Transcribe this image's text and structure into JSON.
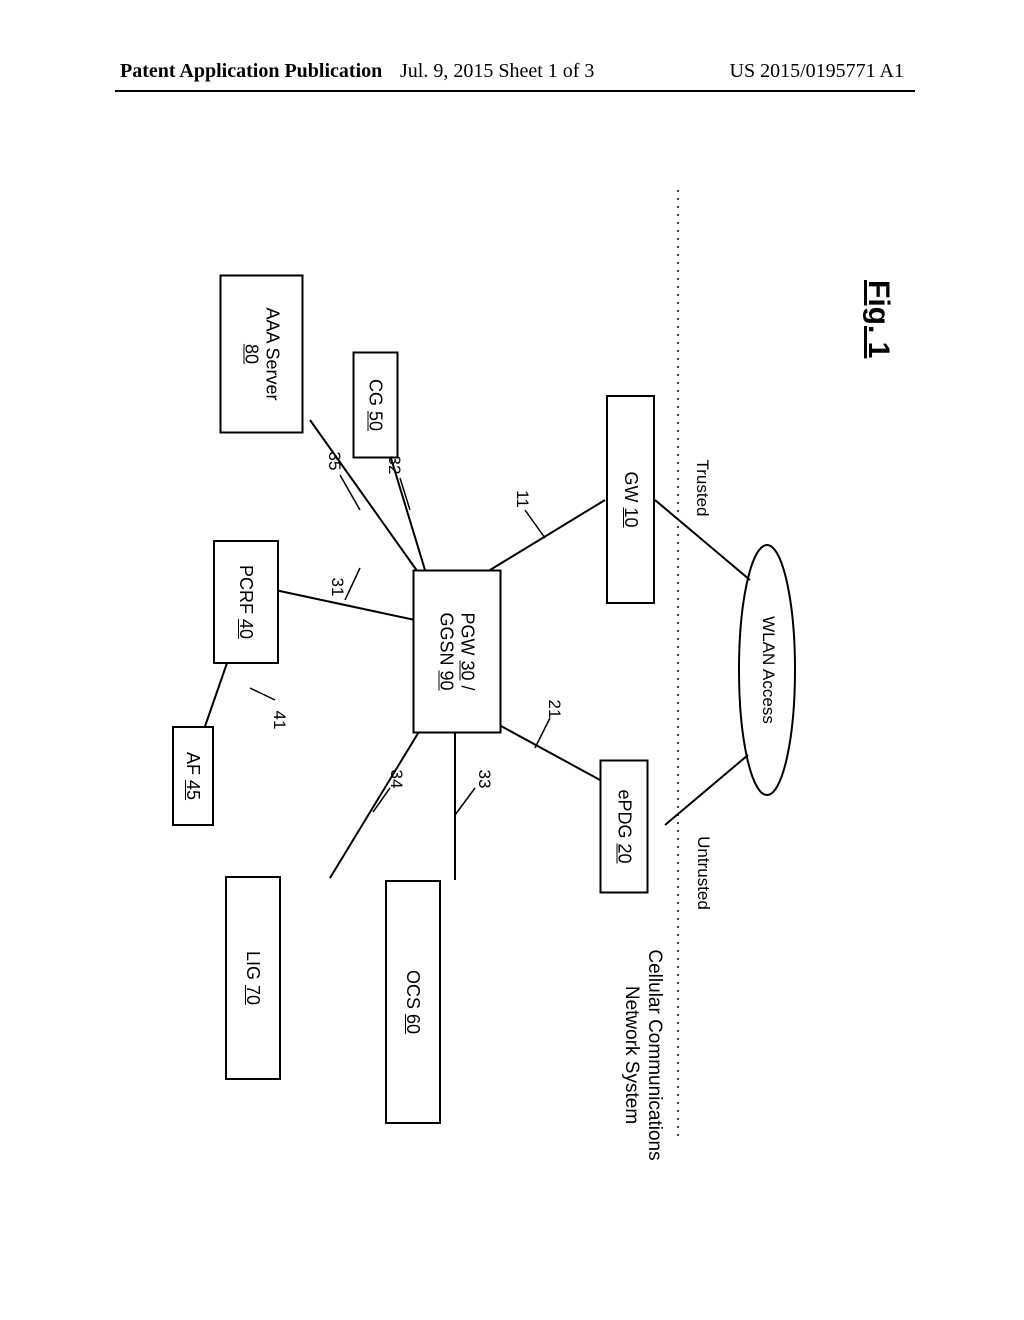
{
  "header": {
    "left": "Patent Application Publication",
    "center": "Jul. 9, 2015  Sheet 1 of 3",
    "right": "US 2015/0195771 A1"
  },
  "diagram": {
    "title": "Cellular Communications Network System",
    "figure_label": "Fig. 1",
    "boxes": {
      "af": {
        "label": "AF ",
        "num": "45"
      },
      "pcrf": {
        "label": "PCRF ",
        "num": "40"
      },
      "aaa": {
        "line1": "AAA Server",
        "num": "80"
      },
      "lig": {
        "label": "LIG ",
        "num": "70"
      },
      "ocs": {
        "label": "OCS ",
        "num": "60"
      },
      "cg": {
        "label": "CG ",
        "num": "50"
      },
      "pgw": {
        "line1_a": "PGW ",
        "line1_a_num": "30",
        "line1_b": " /",
        "line2_a": "GGSN ",
        "line2_a_num": "90"
      },
      "epdg": {
        "label": "ePDG ",
        "num": "20"
      },
      "gw": {
        "label": "GW ",
        "num": "10"
      },
      "wlan": {
        "label": "WLAN Access"
      }
    },
    "link_labels": {
      "l41": "41",
      "l31": "31",
      "l35": "35",
      "l34": "34",
      "l33": "33",
      "l32": "32",
      "l21": "21",
      "l11": "11"
    },
    "access_labels": {
      "trusted": "Trusted",
      "untrusted": "Untrusted"
    }
  }
}
